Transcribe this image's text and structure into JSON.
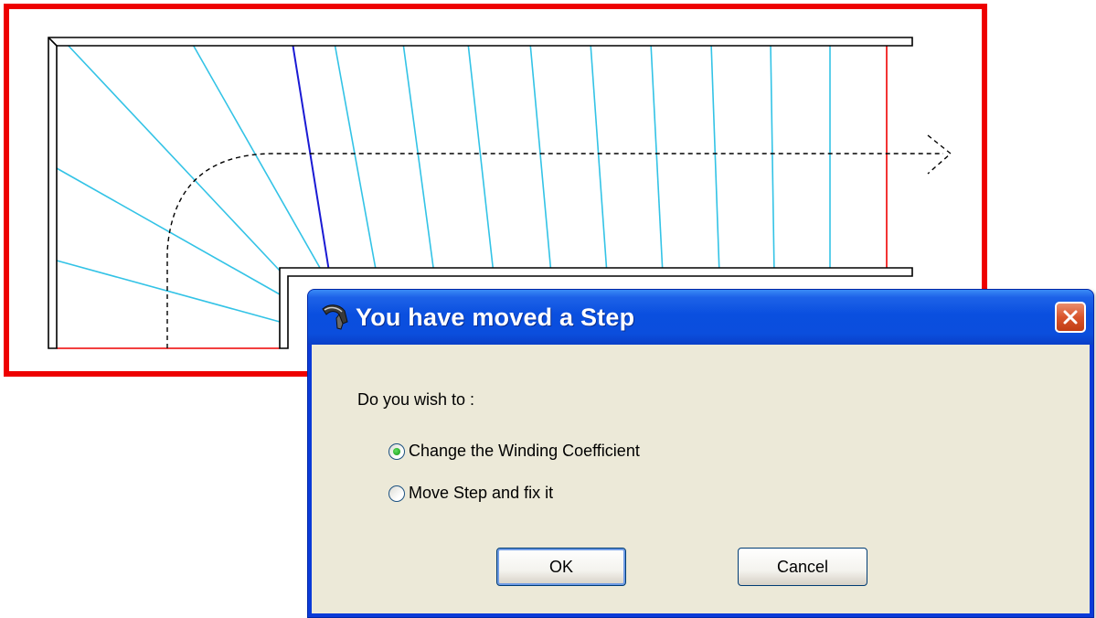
{
  "drawing": {
    "frame_color": "#ee0000",
    "step_line_color": "#33c3e6",
    "selected_step_color": "#1a1ad4",
    "edge_color": "#ee0000",
    "walking_line": "dashed arrow"
  },
  "dialog": {
    "title": "You have moved a Step",
    "app_icon": "stair-app-icon",
    "close_icon": "close-icon",
    "prompt": "Do you wish to :",
    "options": [
      {
        "label": "Change the Winding Coefficient",
        "selected": true
      },
      {
        "label": "Move Step and fix it",
        "selected": false
      }
    ],
    "ok_label": "OK",
    "cancel_label": "Cancel",
    "colors": {
      "title_bar": "#0a4fdf",
      "body": "#ece9d8",
      "close_button": "#d9542b"
    }
  }
}
